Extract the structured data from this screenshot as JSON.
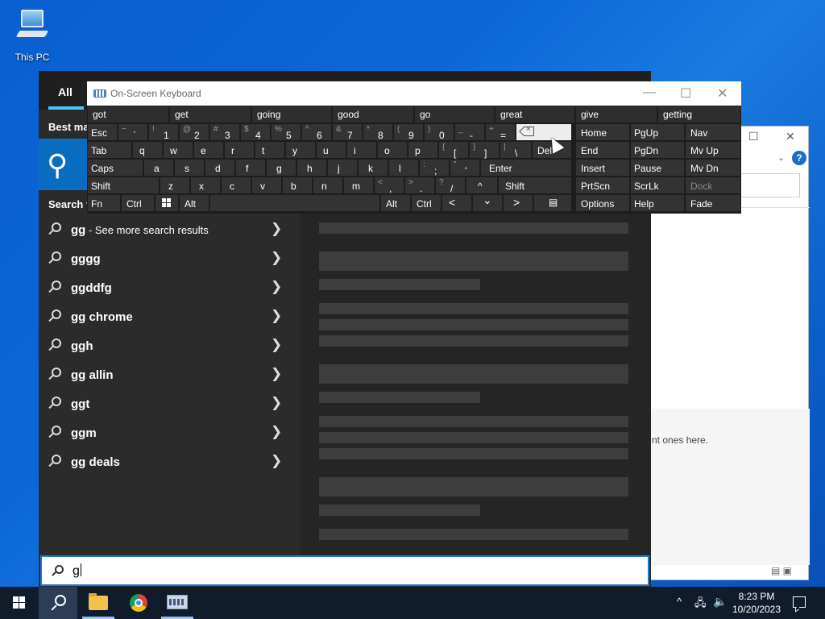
{
  "desktop": {
    "this_pc_label": "This PC"
  },
  "background_window": {
    "hint_text": "nt ones here.",
    "help_glyph": "?",
    "maximize_glyph": "☐",
    "close_glyph": "✕",
    "chevron_glyph": "⌄"
  },
  "start": {
    "tab_all": "All",
    "best_match_label": "Best ma",
    "search_web_label": "Search t",
    "suggestions": [
      {
        "text": "gg",
        "more": " - See more search results"
      },
      {
        "text": "gggg",
        "more": ""
      },
      {
        "text": "ggddfg",
        "more": ""
      },
      {
        "text": "gg chrome",
        "more": ""
      },
      {
        "text": "ggh",
        "more": ""
      },
      {
        "text": "gg allin",
        "more": ""
      },
      {
        "text": "ggt",
        "more": ""
      },
      {
        "text": "ggm",
        "more": ""
      },
      {
        "text": "gg deals",
        "more": ""
      }
    ],
    "arrow_glyph": "❯"
  },
  "search_box": {
    "query": "g"
  },
  "osk": {
    "title": "On-Screen Keyboard",
    "predictions": [
      "got",
      "get",
      "going",
      "good",
      "go",
      "great",
      "give",
      "getting"
    ],
    "row1": [
      {
        "shift": "~",
        "main": "`"
      },
      {
        "shift": "!",
        "main": "1"
      },
      {
        "shift": "@",
        "main": "2"
      },
      {
        "shift": "#",
        "main": "3"
      },
      {
        "shift": "$",
        "main": "4"
      },
      {
        "shift": "%",
        "main": "5"
      },
      {
        "shift": "^",
        "main": "6"
      },
      {
        "shift": "&",
        "main": "7"
      },
      {
        "shift": "*",
        "main": "8"
      },
      {
        "shift": "(",
        "main": "9"
      },
      {
        "shift": ")",
        "main": "0"
      },
      {
        "shift": "_",
        "main": "-"
      },
      {
        "shift": "+",
        "main": "="
      }
    ],
    "esc": "Esc",
    "tab": "Tab",
    "row2": [
      "q",
      "w",
      "e",
      "r",
      "t",
      "y",
      "u",
      "i",
      "o",
      "p"
    ],
    "row2_brackets": [
      {
        "shift": "{",
        "main": "["
      },
      {
        "shift": "}",
        "main": "]"
      },
      {
        "shift": "|",
        "main": "\\"
      }
    ],
    "del": "Del",
    "caps": "Caps",
    "row3": [
      "a",
      "s",
      "d",
      "f",
      "g",
      "h",
      "j",
      "k",
      "l"
    ],
    "row3_punct": [
      {
        "shift": ":",
        "main": ";"
      },
      {
        "shift": "\"",
        "main": "'"
      }
    ],
    "enter": "Enter",
    "shift": "Shift",
    "row4": [
      "z",
      "x",
      "c",
      "v",
      "b",
      "n",
      "m"
    ],
    "row4_punct": [
      {
        "shift": "<",
        "main": ","
      },
      {
        "shift": ">",
        "main": "."
      },
      {
        "shift": "?",
        "main": "/"
      }
    ],
    "up_arrow": "^",
    "fn": "Fn",
    "ctrl": "Ctrl",
    "alt": "Alt",
    "left_arrow": "<",
    "down_arrow": "⌄",
    "right_arrow": ">",
    "nav_keys": [
      [
        "Home",
        "PgUp",
        "Nav"
      ],
      [
        "End",
        "PgDn",
        "Mv Up"
      ],
      [
        "Insert",
        "Pause",
        "Mv Dn"
      ],
      [
        "PrtScn",
        "ScrLk",
        "Dock"
      ],
      [
        "Options",
        "Help",
        "Fade"
      ]
    ],
    "minimize_glyph": "—",
    "maximize_glyph": "☐",
    "close_glyph": "✕"
  },
  "taskbar": {
    "time": "8:23 PM",
    "date": "10/20/2023",
    "tray_chevron": "^",
    "network_glyph": "🖧",
    "volume_glyph": "🔈"
  }
}
